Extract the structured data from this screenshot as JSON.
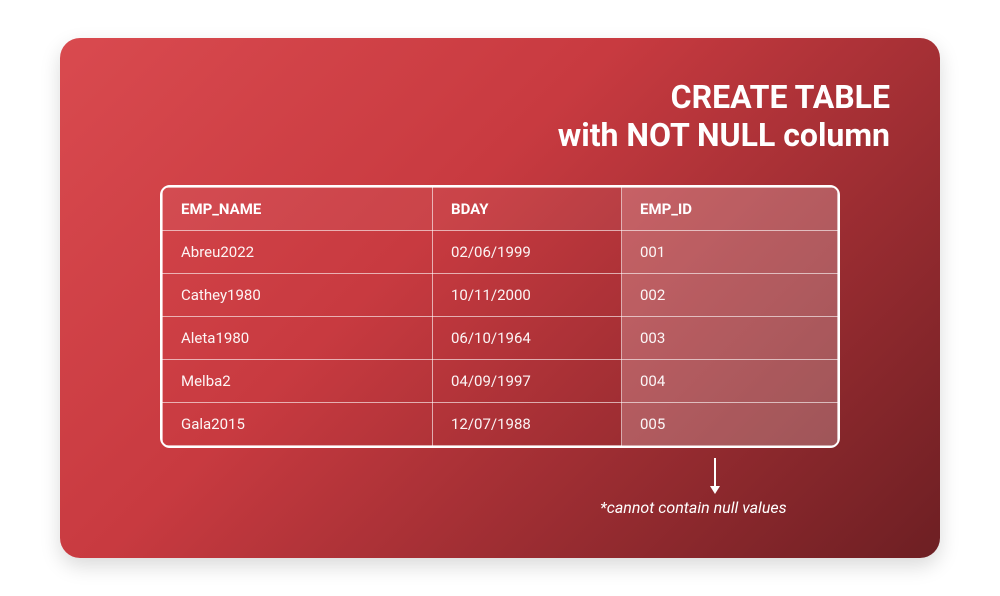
{
  "title_line1": "CREATE TABLE",
  "title_line2": "with NOT NULL column",
  "columns": {
    "c1": "EMP_NAME",
    "c2": "BDAY",
    "c3": "EMP_ID"
  },
  "rows": [
    {
      "name": "Abreu2022",
      "bday": "02/06/1999",
      "id": "001"
    },
    {
      "name": "Cathey1980",
      "bday": "10/11/2000",
      "id": "002"
    },
    {
      "name": "Aleta1980",
      "bday": "06/10/1964",
      "id": "003"
    },
    {
      "name": "Melba2",
      "bday": "04/09/1997",
      "id": "004"
    },
    {
      "name": "Gala2015",
      "bday": "12/07/1988",
      "id": "005"
    }
  ],
  "footnote": "*cannot contain null values",
  "chart_data": {
    "type": "table",
    "title": "CREATE TABLE with NOT NULL column",
    "columns": [
      "EMP_NAME",
      "BDAY",
      "EMP_ID"
    ],
    "highlighted_column": "EMP_ID",
    "annotation": "*cannot contain null values",
    "rows": [
      [
        "Abreu2022",
        "02/06/1999",
        "001"
      ],
      [
        "Cathey1980",
        "10/11/2000",
        "002"
      ],
      [
        "Aleta1980",
        "06/10/1964",
        "003"
      ],
      [
        "Melba2",
        "04/09/1997",
        "004"
      ],
      [
        "Gala2015",
        "12/07/1988",
        "005"
      ]
    ]
  }
}
